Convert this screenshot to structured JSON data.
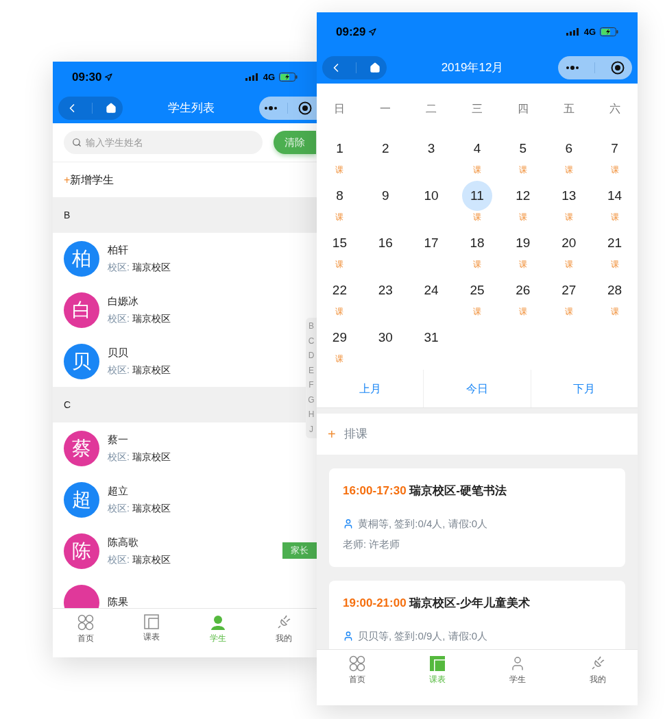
{
  "student_screen": {
    "status_bar": {
      "time": "09:30",
      "network": "4G"
    },
    "nav": {
      "title": "学生列表"
    },
    "search": {
      "placeholder": "输入学生姓名",
      "clear_button": "清除"
    },
    "add_button": {
      "icon": "+",
      "label": "新增学生"
    },
    "sections": [
      {
        "letter": "B",
        "students": [
          {
            "avatar": "柏",
            "name": "柏轩",
            "campus_label": "校区:",
            "campus": "瑞京校区",
            "color": "#1a86f5"
          },
          {
            "avatar": "白",
            "name": "白嫄冰",
            "campus_label": "校区:",
            "campus": "瑞京校区",
            "color": "#e0389a"
          },
          {
            "avatar": "贝",
            "name": "贝贝",
            "campus_label": "校区:",
            "campus": "瑞京校区",
            "color": "#1a86f5"
          }
        ]
      },
      {
        "letter": "C",
        "students": [
          {
            "avatar": "蔡",
            "name": "蔡一",
            "campus_label": "校区:",
            "campus": "瑞京校区",
            "color": "#e0389a"
          },
          {
            "avatar": "超",
            "name": "超立",
            "campus_label": "校区:",
            "campus": "瑞京校区",
            "color": "#1a86f5"
          },
          {
            "avatar": "陈",
            "name": "陈高歌",
            "campus_label": "校区:",
            "campus": "瑞京校区",
            "color": "#e0389a",
            "tag": "家长"
          },
          {
            "name": "陈果",
            "color": "#e0389a"
          }
        ]
      }
    ],
    "index_letters": [
      "B",
      "C",
      "D",
      "E",
      "F",
      "G",
      "H",
      "J"
    ],
    "tab_bar": [
      {
        "kind": "home",
        "label": "首页",
        "selected": false
      },
      {
        "kind": "schedule",
        "label": "课表",
        "selected": false
      },
      {
        "kind": "student",
        "label": "学生",
        "selected": true
      },
      {
        "kind": "mine",
        "label": "我的",
        "selected": false
      }
    ]
  },
  "calendar_screen": {
    "status_bar": {
      "time": "09:29",
      "network": "4G"
    },
    "nav": {
      "title": "2019年12月"
    },
    "weekdays": [
      "日",
      "一",
      "二",
      "三",
      "四",
      "五",
      "六"
    ],
    "days": [
      {
        "day": "1",
        "mark": "课",
        "selected": false
      },
      {
        "day": "2",
        "selected": false
      },
      {
        "day": "3",
        "selected": false
      },
      {
        "day": "4",
        "mark": "课",
        "selected": false
      },
      {
        "day": "5",
        "mark": "课",
        "selected": false
      },
      {
        "day": "6",
        "mark": "课",
        "selected": false
      },
      {
        "day": "7",
        "mark": "课",
        "selected": false
      },
      {
        "day": "8",
        "mark": "课",
        "selected": false
      },
      {
        "day": "9",
        "selected": false
      },
      {
        "day": "10",
        "selected": false
      },
      {
        "day": "11",
        "mark": "课",
        "selected": true
      },
      {
        "day": "12",
        "mark": "课",
        "selected": false
      },
      {
        "day": "13",
        "mark": "课",
        "selected": false
      },
      {
        "day": "14",
        "mark": "课",
        "selected": false
      },
      {
        "day": "15",
        "mark": "课",
        "selected": false
      },
      {
        "day": "16",
        "selected": false
      },
      {
        "day": "17",
        "selected": false
      },
      {
        "day": "18",
        "mark": "课",
        "selected": false
      },
      {
        "day": "19",
        "mark": "课",
        "selected": false
      },
      {
        "day": "20",
        "mark": "课",
        "selected": false
      },
      {
        "day": "21",
        "mark": "课",
        "selected": false
      },
      {
        "day": "22",
        "mark": "课",
        "selected": false
      },
      {
        "day": "23",
        "selected": false
      },
      {
        "day": "24",
        "selected": false
      },
      {
        "day": "25",
        "mark": "课",
        "selected": false
      },
      {
        "day": "26",
        "mark": "课",
        "selected": false
      },
      {
        "day": "27",
        "mark": "课",
        "selected": false
      },
      {
        "day": "28",
        "mark": "课",
        "selected": false
      },
      {
        "day": "29",
        "mark": "课",
        "selected": false
      },
      {
        "day": "30",
        "selected": false
      },
      {
        "day": "31",
        "selected": false
      }
    ],
    "month_buttons": [
      "上月",
      "今日",
      "下月"
    ],
    "schedule_button": {
      "icon": "+",
      "label": "排课"
    },
    "lessons": [
      {
        "time": "16:00-17:30",
        "title": "瑞京校区-硬笔书法",
        "attendance": "黄桐等, 签到:0/4人, 请假:0人",
        "teacher": "老师: 许老师"
      },
      {
        "time": "19:00-21:00",
        "title": "瑞京校区-少年儿童美术",
        "attendance": "贝贝等, 签到:0/9人, 请假:0人"
      }
    ],
    "tab_bar": [
      {
        "kind": "home",
        "label": "首页",
        "selected": false
      },
      {
        "kind": "schedule",
        "label": "课表",
        "selected": true
      },
      {
        "kind": "student",
        "label": "学生",
        "selected": false
      },
      {
        "kind": "mine",
        "label": "我的",
        "selected": false
      }
    ]
  }
}
